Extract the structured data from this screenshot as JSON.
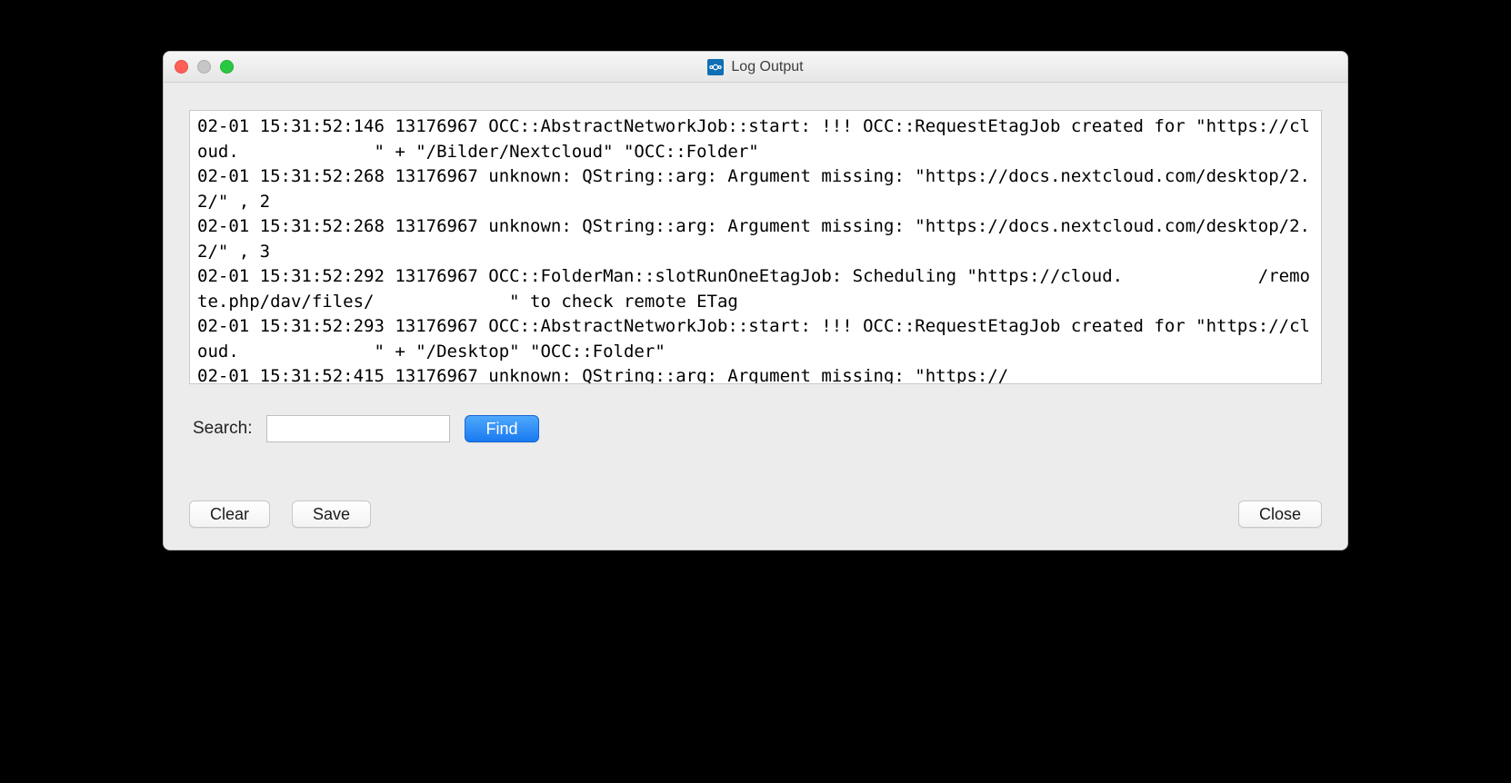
{
  "window": {
    "title": "Log Output"
  },
  "log_text": "02-01 15:31:52:146 13176967 OCC::AbstractNetworkJob::start: !!! OCC::RequestEtagJob created for \"https://cloud.             \" + \"/Bilder/Nextcloud\" \"OCC::Folder\"\n02-01 15:31:52:268 13176967 unknown: QString::arg: Argument missing: \"https://docs.nextcloud.com/desktop/2.2/\" , 2\n02-01 15:31:52:268 13176967 unknown: QString::arg: Argument missing: \"https://docs.nextcloud.com/desktop/2.2/\" , 3\n02-01 15:31:52:292 13176967 OCC::FolderMan::slotRunOneEtagJob: Scheduling \"https://cloud.             /remote.php/dav/files/             \" to check remote ETag\n02-01 15:31:52:293 13176967 OCC::AbstractNetworkJob::start: !!! OCC::RequestEtagJob created for \"https://cloud.             \" + \"/Desktop\" \"OCC::Folder\"\n02-01 15:31:52:415 13176967 unknown: QString::arg: Argument missing: \"https://",
  "search": {
    "label": "Search:",
    "value": "",
    "find_label": "Find"
  },
  "buttons": {
    "clear": "Clear",
    "save": "Save",
    "close": "Close"
  }
}
